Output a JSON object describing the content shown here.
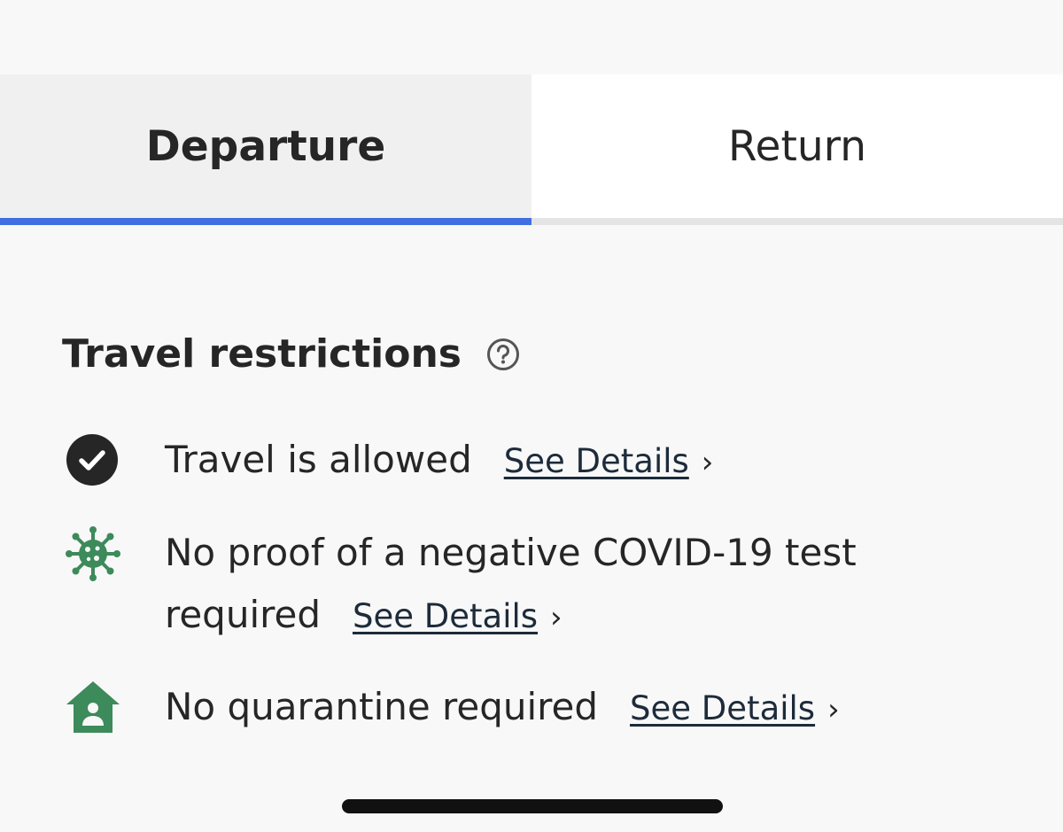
{
  "tabs": {
    "departure_label": "Departure",
    "return_label": "Return"
  },
  "colors": {
    "active_tab_underline": "#3f6fe0",
    "status_green": "#3d8a5a",
    "check_circle": "#262626"
  },
  "restrictions": {
    "title": "Travel restrictions",
    "help_icon": "question-circle-icon",
    "items": [
      {
        "icon": "check-circle-icon",
        "text": "Travel is allowed",
        "link": "See Details"
      },
      {
        "icon": "virus-icon",
        "text_line1": "No proof of a negative COVID-19 test",
        "text_line2": "required",
        "link": "See Details"
      },
      {
        "icon": "house-person-icon",
        "text": "No quarantine required",
        "link": "See Details"
      }
    ]
  }
}
